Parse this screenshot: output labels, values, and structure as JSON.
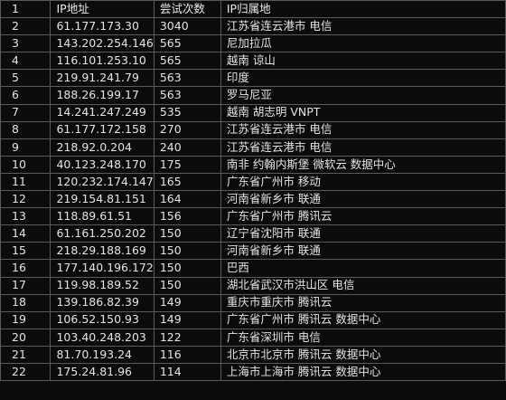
{
  "table": {
    "headers": [
      "1",
      "IP地址",
      "尝试次数",
      "IP归属地"
    ],
    "rows": [
      [
        "2",
        "61.177.173.30",
        "3040",
        "江苏省连云港市 电信"
      ],
      [
        "3",
        "143.202.254.146",
        "565",
        "尼加拉瓜"
      ],
      [
        "4",
        "116.101.253.10",
        "565",
        "越南 谅山"
      ],
      [
        "5",
        "219.91.241.79",
        "563",
        "印度"
      ],
      [
        "6",
        "188.26.199.17",
        "563",
        "罗马尼亚"
      ],
      [
        "7",
        "14.241.247.249",
        "535",
        "越南 胡志明 VNPT"
      ],
      [
        "8",
        "61.177.172.158",
        "270",
        "江苏省连云港市 电信"
      ],
      [
        "9",
        "218.92.0.204",
        "240",
        "江苏省连云港市 电信"
      ],
      [
        "10",
        "40.123.248.170",
        "175",
        "南非 约翰内斯堡 微软云 数据中心"
      ],
      [
        "11",
        "120.232.174.147",
        "165",
        "广东省广州市 移动"
      ],
      [
        "12",
        "219.154.81.151",
        "164",
        "河南省新乡市 联通"
      ],
      [
        "13",
        "118.89.61.51",
        "156",
        "广东省广州市 腾讯云"
      ],
      [
        "14",
        "61.161.250.202",
        "150",
        "辽宁省沈阳市 联通"
      ],
      [
        "15",
        "218.29.188.169",
        "150",
        "河南省新乡市 联通"
      ],
      [
        "16",
        "177.140.196.172",
        "150",
        "巴西"
      ],
      [
        "17",
        "119.98.189.52",
        "150",
        "湖北省武汉市洪山区 电信"
      ],
      [
        "18",
        "139.186.82.39",
        "149",
        "重庆市重庆市 腾讯云"
      ],
      [
        "19",
        "106.52.150.93",
        "149",
        "广东省广州市 腾讯云 数据中心"
      ],
      [
        "20",
        "103.40.248.203",
        "122",
        "广东省深圳市 电信"
      ],
      [
        "21",
        "81.70.193.24",
        "116",
        "北京市北京市 腾讯云 数据中心"
      ],
      [
        "22",
        "175.24.81.96",
        "114",
        "上海市上海市 腾讯云 数据中心"
      ]
    ]
  }
}
